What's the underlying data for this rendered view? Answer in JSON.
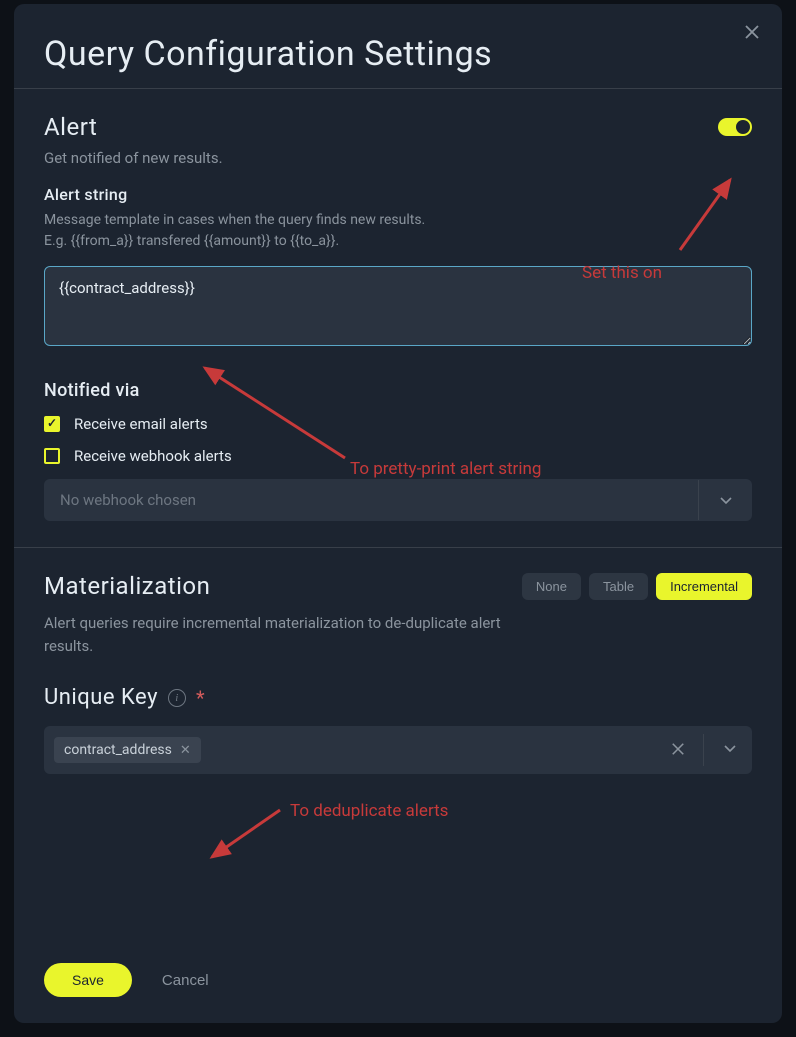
{
  "modal": {
    "title": "Query Configuration Settings"
  },
  "alert": {
    "heading": "Alert",
    "description": "Get notified of new results.",
    "toggle_on": true,
    "string_label": "Alert string",
    "string_help_1": "Message template in cases when the query finds new results.",
    "string_help_2": "E.g. {{from_a}} transfered {{amount}} to {{to_a}}.",
    "string_value": "{{contract_address}}",
    "notified_via_label": "Notified via",
    "email_label": "Receive email alerts",
    "webhook_label": "Receive webhook alerts",
    "webhook_placeholder": "No webhook chosen"
  },
  "materialization": {
    "heading": "Materialization",
    "options": {
      "none": "None",
      "table": "Table",
      "incremental": "Incremental"
    },
    "selected": "Incremental",
    "description": "Alert queries require incremental materialization to de-duplicate alert results.",
    "unique_key_label": "Unique Key",
    "chip_value": "contract_address"
  },
  "footer": {
    "save": "Save",
    "cancel": "Cancel"
  },
  "annotations": {
    "set_on": "Set this on",
    "pretty": "To pretty-print alert string",
    "dedup": "To deduplicate alerts"
  }
}
